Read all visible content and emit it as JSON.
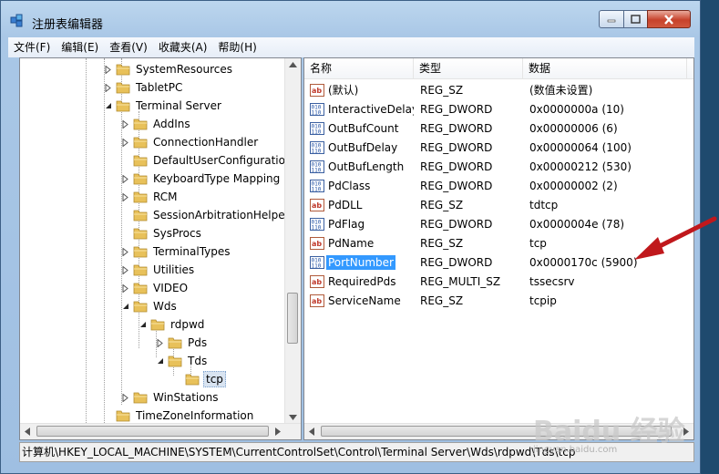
{
  "window": {
    "title": "注册表编辑器"
  },
  "menu": [
    "文件(F)",
    "编辑(E)",
    "查看(V)",
    "收藏夹(A)",
    "帮助(H)"
  ],
  "tree": [
    {
      "label": "SystemResources",
      "level": 0,
      "exp": "collapsed"
    },
    {
      "label": "TabletPC",
      "level": 0,
      "exp": "collapsed"
    },
    {
      "label": "Terminal Server",
      "level": 0,
      "exp": "expanded"
    },
    {
      "label": "AddIns",
      "level": 1,
      "exp": "collapsed"
    },
    {
      "label": "ConnectionHandler",
      "level": 1,
      "exp": "collapsed"
    },
    {
      "label": "DefaultUserConfiguration",
      "level": 1,
      "exp": "none"
    },
    {
      "label": "KeyboardType Mapping",
      "level": 1,
      "exp": "collapsed"
    },
    {
      "label": "RCM",
      "level": 1,
      "exp": "collapsed"
    },
    {
      "label": "SessionArbitrationHelper",
      "level": 1,
      "exp": "none"
    },
    {
      "label": "SysProcs",
      "level": 1,
      "exp": "none"
    },
    {
      "label": "TerminalTypes",
      "level": 1,
      "exp": "collapsed"
    },
    {
      "label": "Utilities",
      "level": 1,
      "exp": "collapsed"
    },
    {
      "label": "VIDEO",
      "level": 1,
      "exp": "collapsed"
    },
    {
      "label": "Wds",
      "level": 1,
      "exp": "expanded"
    },
    {
      "label": "rdpwd",
      "level": 2,
      "exp": "expanded"
    },
    {
      "label": "Pds",
      "level": 3,
      "exp": "collapsed"
    },
    {
      "label": "Tds",
      "level": 3,
      "exp": "expanded"
    },
    {
      "label": "tcp",
      "level": 4,
      "exp": "none",
      "selected": true
    },
    {
      "label": "WinStations",
      "level": 1,
      "exp": "collapsed"
    },
    {
      "label": "TimeZoneInformation",
      "level": 0,
      "exp": "none"
    }
  ],
  "columns": {
    "name": "名称",
    "type": "类型",
    "data": "数据"
  },
  "values": [
    {
      "name": "(默认)",
      "type": "REG_SZ",
      "data": "(数值未设置)",
      "icon": "string-value-icon"
    },
    {
      "name": "InteractiveDelay",
      "type": "REG_DWORD",
      "data": "0x0000000a (10)",
      "icon": "binary-value-icon"
    },
    {
      "name": "OutBufCount",
      "type": "REG_DWORD",
      "data": "0x00000006 (6)",
      "icon": "binary-value-icon"
    },
    {
      "name": "OutBufDelay",
      "type": "REG_DWORD",
      "data": "0x00000064 (100)",
      "icon": "binary-value-icon"
    },
    {
      "name": "OutBufLength",
      "type": "REG_DWORD",
      "data": "0x00000212 (530)",
      "icon": "binary-value-icon"
    },
    {
      "name": "PdClass",
      "type": "REG_DWORD",
      "data": "0x00000002 (2)",
      "icon": "binary-value-icon"
    },
    {
      "name": "PdDLL",
      "type": "REG_SZ",
      "data": "tdtcp",
      "icon": "string-value-icon"
    },
    {
      "name": "PdFlag",
      "type": "REG_DWORD",
      "data": "0x0000004e (78)",
      "icon": "binary-value-icon"
    },
    {
      "name": "PdName",
      "type": "REG_SZ",
      "data": "tcp",
      "icon": "string-value-icon"
    },
    {
      "name": "PortNumber",
      "type": "REG_DWORD",
      "data": "0x0000170c (5900)",
      "icon": "binary-value-icon",
      "selected": true
    },
    {
      "name": "RequiredPds",
      "type": "REG_MULTI_SZ",
      "data": "tssecsrv",
      "icon": "string-value-icon"
    },
    {
      "name": "ServiceName",
      "type": "REG_SZ",
      "data": "tcpip",
      "icon": "string-value-icon"
    }
  ],
  "status": "计算机\\HKEY_LOCAL_MACHINE\\SYSTEM\\CurrentControlSet\\Control\\Terminal Server\\Wds\\rdpwd\\Tds\\tcp",
  "watermark": {
    "main": "Baidu 经验",
    "sub": "jingyan.baidu.com"
  },
  "colors": {
    "selection": "#3399ff",
    "arrow": "#c0181c",
    "folder": "#e8c15a"
  }
}
